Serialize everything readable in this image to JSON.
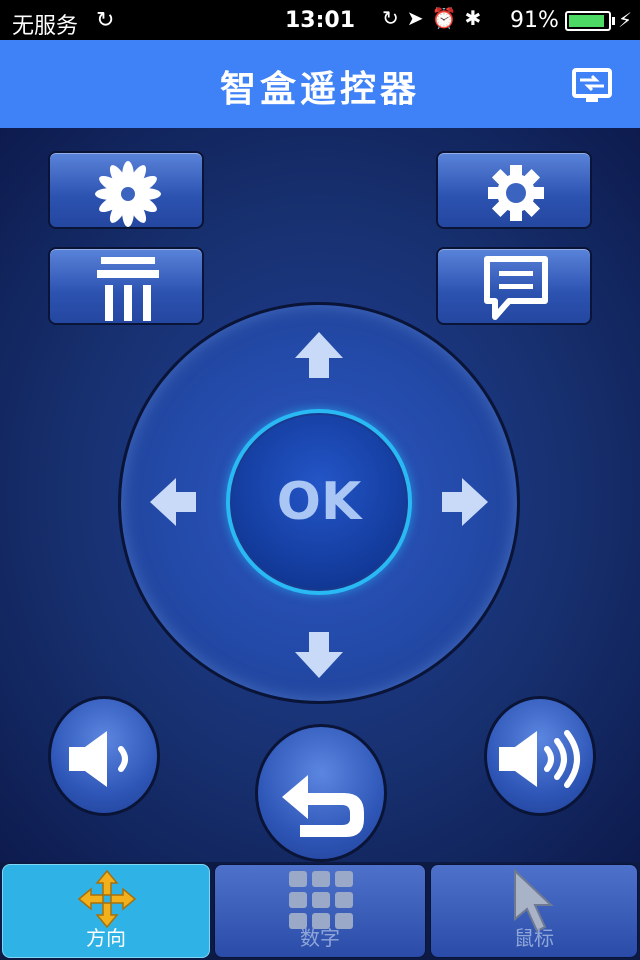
{
  "status_bar": {
    "carrier": "无服务",
    "time": "13:01",
    "battery_percent": "91%",
    "battery_level": 0.91,
    "icons": [
      "sync-icon",
      "rotation-lock-icon",
      "location-icon",
      "alarm-icon",
      "bluetooth-icon",
      "charging-bolt-icon"
    ]
  },
  "header": {
    "title": "智盒遥控器",
    "cast_icon": "screen-cast-icon"
  },
  "controls": {
    "home_icon": "flower-home-icon",
    "settings_icon": "gear-icon",
    "clear_icon": "trash-icon",
    "message_icon": "chat-bubble-icon",
    "ok_label": "OK",
    "volume_down_icon": "volume-down-icon",
    "volume_up_icon": "volume-up-icon",
    "back_icon": "back-return-icon"
  },
  "tabs": [
    {
      "label": "方向",
      "icon": "direction-arrows-icon",
      "active": true
    },
    {
      "label": "数字",
      "icon": "numpad-grid-icon",
      "active": false
    },
    {
      "label": "鼠标",
      "icon": "mouse-pointer-icon",
      "active": false
    }
  ],
  "colors": {
    "accent": "#3f81f6",
    "active_tab": "#2fb3e6",
    "ok_ring": "#29b9f5",
    "battery": "#4cd964"
  }
}
